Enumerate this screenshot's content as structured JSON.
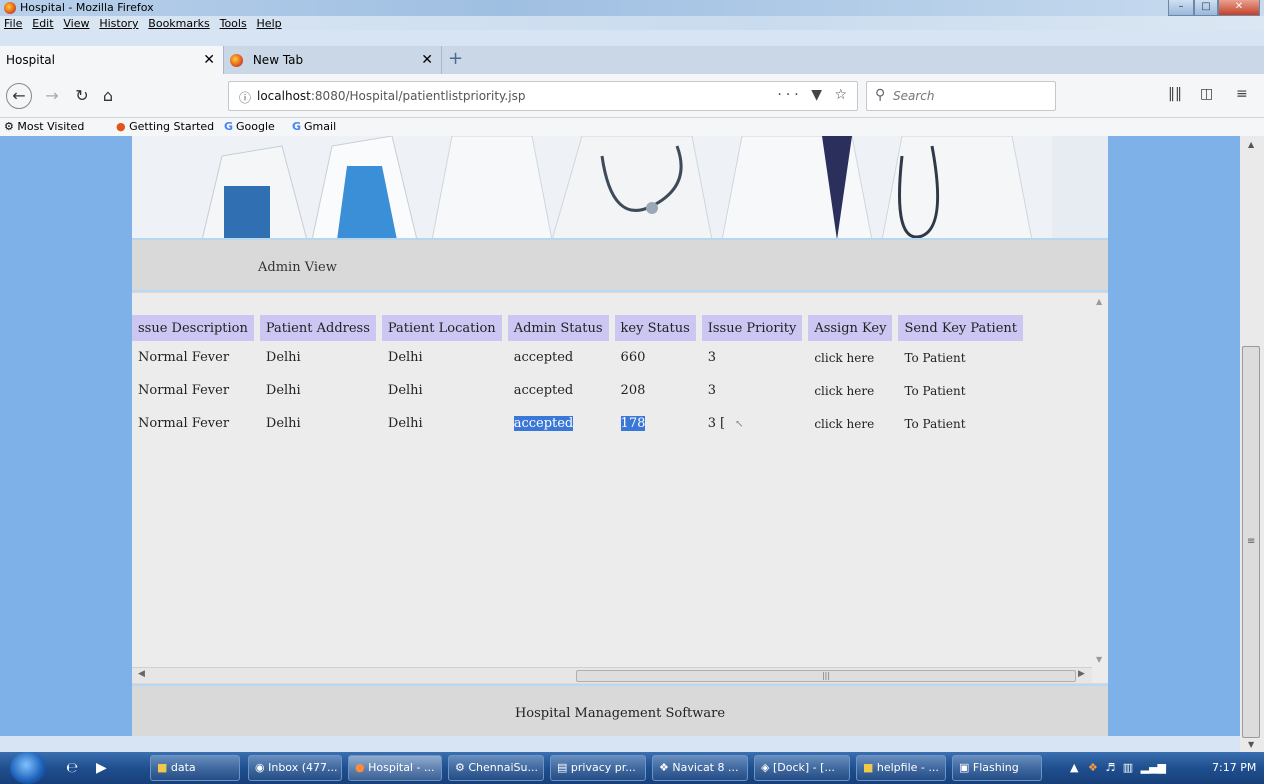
{
  "window": {
    "title": "Hospital - Mozilla Firefox"
  },
  "menubar": [
    "File",
    "Edit",
    "View",
    "History",
    "Bookmarks",
    "Tools",
    "Help"
  ],
  "tabs": [
    {
      "label": "Hospital"
    },
    {
      "label": "New Tab"
    }
  ],
  "nav": {
    "url_host": "localhost",
    "url_rest": ":8080/Hospital/patientlistpriority.jsp",
    "search_placeholder": "Search"
  },
  "bookmarks": [
    "Most Visited",
    "Getting Started",
    "Google",
    "Gmail"
  ],
  "page": {
    "section_title": "Admin View",
    "table": {
      "headers": [
        "ssue Description",
        "Patient Address",
        "Patient Location",
        "Admin Status",
        "key Status",
        "Issue Priority",
        "Assign Key",
        "Send Key Patient"
      ],
      "rows": [
        [
          "Normal Fever",
          "Delhi",
          "Delhi",
          "accepted",
          "660",
          "3",
          "click here",
          "To Patient"
        ],
        [
          "Normal Fever",
          "Delhi",
          "Delhi",
          "accepted",
          "208",
          "3",
          "click here",
          "To Patient"
        ],
        [
          "Normal Fever",
          "Delhi",
          "Delhi",
          "accepted",
          "178",
          "3",
          "click here",
          "To Patient"
        ]
      ]
    },
    "footer": "Hospital Management Software"
  },
  "taskbar": {
    "buttons": [
      "data",
      "Inbox (477...",
      "Hospital - ...",
      "ChennaiSu...",
      "privacy pr...",
      "Navicat 8 ...",
      "[Dock] - [...",
      "helpfile - ...",
      "Flashing"
    ],
    "clock": "7:17 PM"
  }
}
